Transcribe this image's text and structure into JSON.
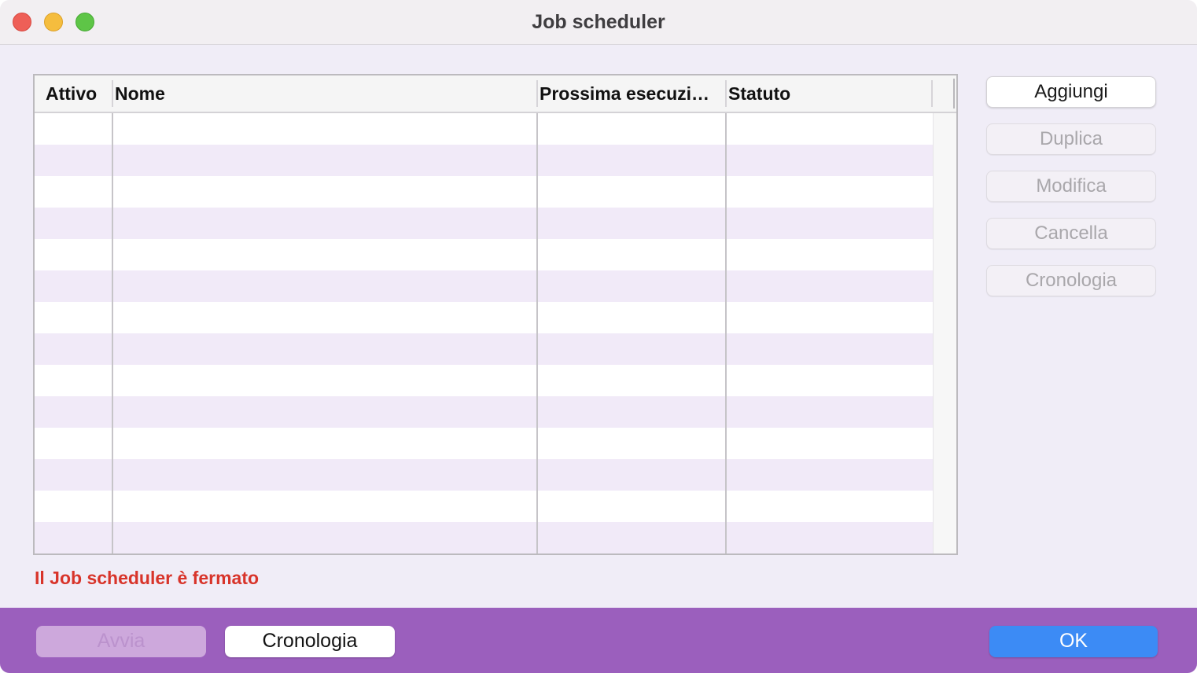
{
  "window": {
    "title": "Job scheduler"
  },
  "table": {
    "columns": [
      "Attivo",
      "Nome",
      "Prossima esecuzi…",
      "Statuto"
    ],
    "rows": []
  },
  "side_buttons": {
    "add": "Aggiungi",
    "duplicate": "Duplica",
    "edit": "Modifica",
    "delete": "Cancella",
    "history": "Cronologia"
  },
  "status_text": "Il Job scheduler è fermato",
  "footer": {
    "start": "Avvia",
    "history": "Cronologia",
    "ok": "OK"
  },
  "colors": {
    "accent_footer": "#9b5fbd",
    "ok_button": "#3c8bf5",
    "status_error": "#d8342a",
    "row_alt": "#f1eaf8"
  }
}
